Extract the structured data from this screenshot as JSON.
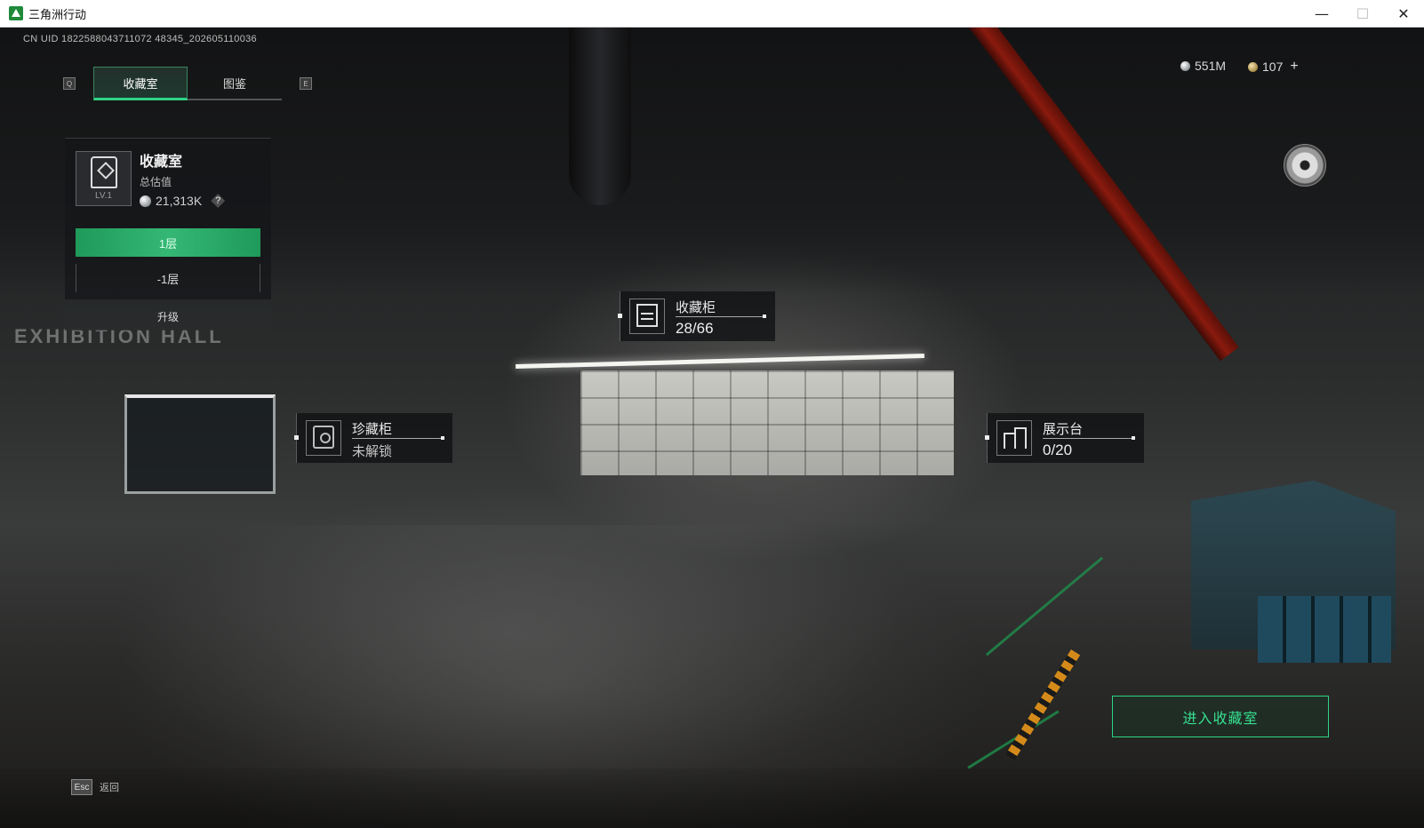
{
  "window": {
    "title": "三角洲行动",
    "minimize": "—",
    "maximize": "☐",
    "close": "✕"
  },
  "hud": {
    "uid": "CN UID 1822588043711072 48345_202605110036",
    "tabs": [
      {
        "label": "收藏室",
        "active": true
      },
      {
        "label": "图鉴",
        "active": false
      }
    ],
    "tab_key_left": "Q",
    "tab_key_right": "E",
    "currency": {
      "silver": "551M",
      "gold": "107",
      "plus": "+"
    }
  },
  "room_panel": {
    "name": "收藏室",
    "level": "LV.1",
    "estimated_label": "总估值",
    "estimated_value": "21,313K",
    "help": "?",
    "floors": [
      {
        "label": "1层",
        "active": true
      },
      {
        "label": "-1层",
        "active": false
      }
    ],
    "upgrade": "升级"
  },
  "markers": {
    "cabinet": {
      "title": "收藏柜",
      "value": "28/66"
    },
    "safe": {
      "title": "珍藏柜",
      "value": "未解锁"
    },
    "display": {
      "title": "展示台",
      "value": "0/20"
    }
  },
  "scene_text": {
    "exhibition": "EXHIBITION HALL"
  },
  "actions": {
    "enter": "进入收藏室",
    "esc_key": "Esc",
    "back": "返回"
  },
  "colors": {
    "accent_green": "#2fd386",
    "pipe_red": "#8a1a0e"
  }
}
